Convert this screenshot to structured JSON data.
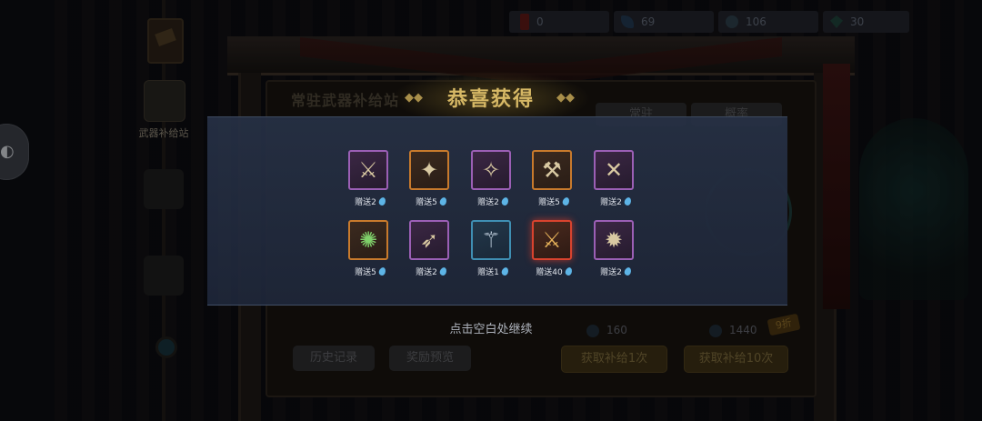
{
  "resources": {
    "ticket": "0",
    "feather": "69",
    "coin": "106",
    "gem": "30"
  },
  "side_menu": {
    "weapon_supply_label": "武器补给站"
  },
  "background_panel": {
    "title": "常驻武器补给站",
    "tabs": [
      "常驻",
      "概率"
    ],
    "cost_single": "160",
    "cost_ten": "1440",
    "discount_badge": "9折",
    "buttons": {
      "history": "历史记录",
      "preview": "奖励预览",
      "draw_one": "获取补给1次",
      "draw_ten": "获取补给10次"
    }
  },
  "result": {
    "title": "恭喜获得",
    "items": [
      {
        "icon": "crossed-swords-icon",
        "rarity": "purple",
        "caption": "赠送2"
      },
      {
        "icon": "winged-creature-icon",
        "rarity": "orange",
        "caption": "赠送5"
      },
      {
        "icon": "winged-mace-icon",
        "rarity": "purple",
        "caption": "赠送2"
      },
      {
        "icon": "war-hammer-icon",
        "rarity": "orange",
        "caption": "赠送5"
      },
      {
        "icon": "twin-blades-icon",
        "rarity": "purple",
        "caption": "赠送2"
      },
      {
        "icon": "green-orb-staff-icon",
        "rarity": "orange",
        "caption": "赠送5"
      },
      {
        "icon": "fish-blade-icon",
        "rarity": "purple",
        "caption": "赠送2"
      },
      {
        "icon": "battle-axe-icon",
        "rarity": "blue",
        "caption": "赠送1"
      },
      {
        "icon": "flame-swords-icon",
        "rarity": "red",
        "caption": "赠送40"
      },
      {
        "icon": "orb-scepter-icon",
        "rarity": "purple",
        "caption": "赠送2"
      }
    ],
    "continue_hint": "点击空白处继续"
  },
  "colors": {
    "title_gold": "#d6b865",
    "rarity_purple": "#9b5fb5",
    "rarity_orange": "#c87a2c",
    "rarity_blue": "#3f8fb3",
    "rarity_red": "#d8432e"
  }
}
